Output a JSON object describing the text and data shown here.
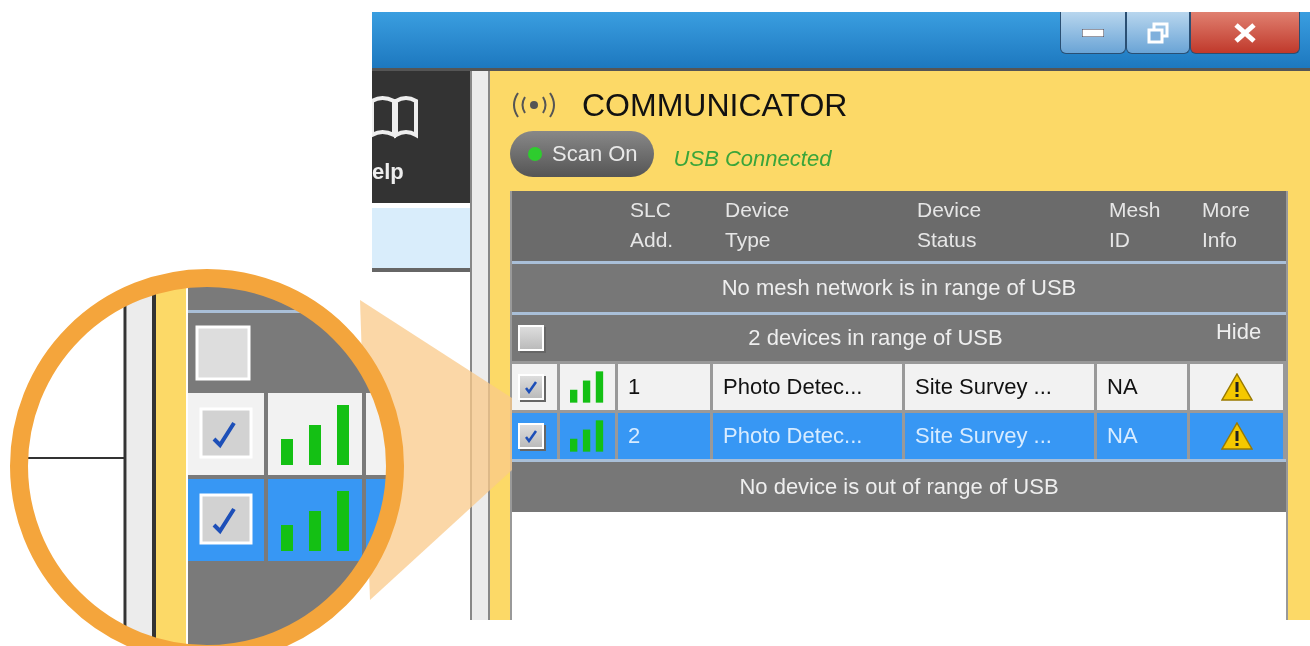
{
  "sidebar": {
    "help_label": "elp"
  },
  "communicator": {
    "title": "COMMUNICATOR",
    "scan_button": {
      "label": "Scan On",
      "on": true
    },
    "status": "USB Connected"
  },
  "table": {
    "columns": [
      {
        "lines": [
          "SLC",
          "Add."
        ]
      },
      {
        "lines": [
          "Device",
          "Type"
        ]
      },
      {
        "lines": [
          "Device",
          "Status"
        ]
      },
      {
        "lines": [
          "Mesh",
          "ID"
        ]
      },
      {
        "lines": [
          "More",
          "Info"
        ]
      }
    ],
    "mesh_message": "No mesh network is in range of USB",
    "in_range_group": {
      "label": "2 devices in range of USB",
      "checked": false,
      "toggle": "Hide"
    },
    "rows": [
      {
        "checked": true,
        "selected": false,
        "slc": "1",
        "device_type": "Photo Detec...",
        "device_status": "Site Survey ...",
        "mesh_id": "NA"
      },
      {
        "checked": true,
        "selected": true,
        "slc": "2",
        "device_type": "Photo Detec...",
        "device_status": "Site Survey ...",
        "mesh_id": "NA"
      }
    ],
    "out_of_range_message": "No device is out of range of USB"
  }
}
